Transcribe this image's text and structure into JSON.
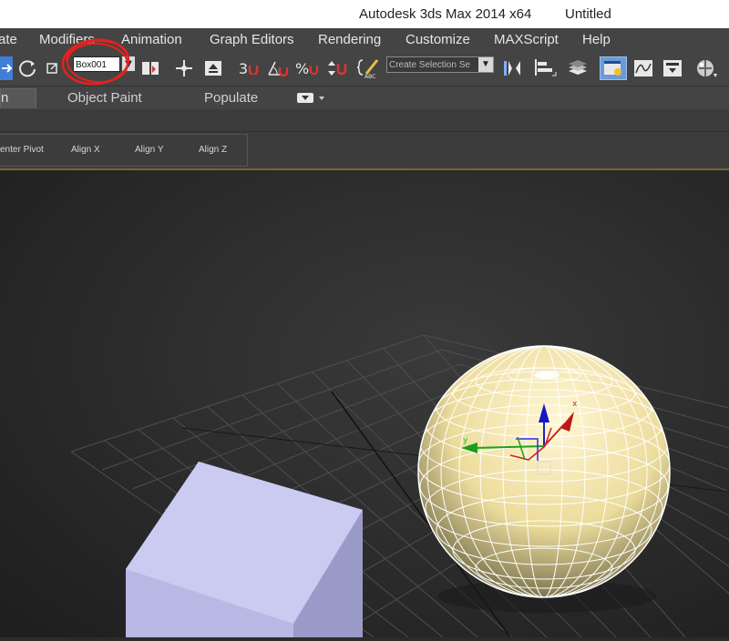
{
  "title": {
    "app": "Autodesk 3ds Max  2014 x64",
    "doc": "Untitled"
  },
  "menu": [
    "ate",
    "Modifiers",
    "Animation",
    "Graph Editors",
    "Rendering",
    "Customize",
    "MAXScript",
    "Help"
  ],
  "toolbar": {
    "name_field": "Box001",
    "selection_set_placeholder": "Create Selection Se",
    "snap_toggle_label": "3",
    "percent_snap_label": "%"
  },
  "ribbon": {
    "tabs": [
      "n",
      "Object Paint",
      "Populate"
    ],
    "buttons": [
      "enter Pivot",
      "Align X",
      "Align Y",
      "Align Z"
    ]
  },
  "colors": {
    "accent": "#7a6530",
    "annotation": "#e8201e",
    "box": "#c9c9f0",
    "sphere": "#efe0a0"
  },
  "icons": [
    "move-icon",
    "rotate-icon",
    "select-link-icon",
    "mirror-icon",
    "align-icon",
    "curve-editor-icon",
    "material-editor-icon"
  ]
}
